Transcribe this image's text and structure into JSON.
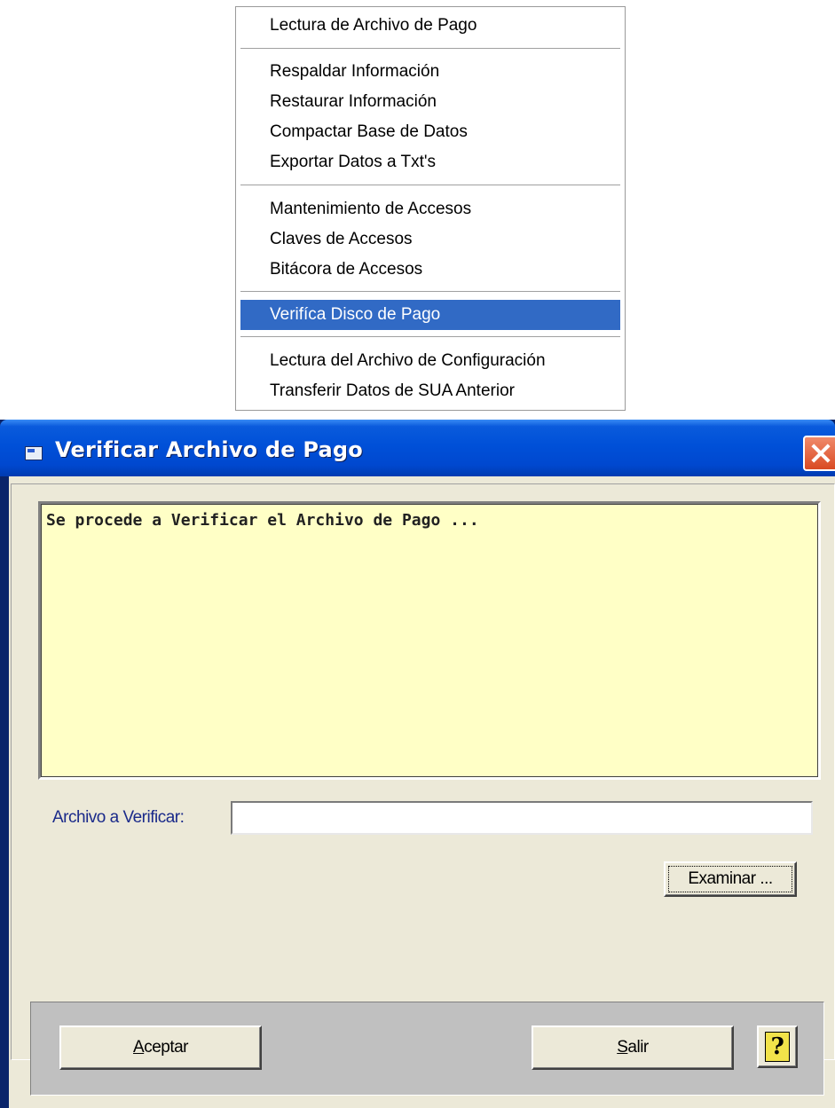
{
  "menu": {
    "items": [
      {
        "label": "Lectura de Archivo de Pago"
      },
      {
        "label": "Respaldar Información"
      },
      {
        "label": "Restaurar Información"
      },
      {
        "label": "Compactar Base de Datos"
      },
      {
        "label": "Exportar Datos a Txt's"
      },
      {
        "label": "Mantenimiento de Accesos"
      },
      {
        "label": "Claves de Accesos"
      },
      {
        "label": "Bitácora de Accesos"
      },
      {
        "label": "Verifíca Disco de Pago",
        "selected": true
      },
      {
        "label": "Lectura del Archivo de Configuración"
      },
      {
        "label": "Transferir Datos de SUA Anterior"
      }
    ]
  },
  "dialog": {
    "title": "Verificar Archivo de Pago",
    "icon": "window-icon",
    "log_text": "Se procede a Verificar el Archivo de Pago ...",
    "file_label": "Archivo a Verificar:",
    "file_value": "",
    "browse_label": "Examinar ...",
    "accept_label_rest": "ceptar",
    "accept_mnemonic": "A",
    "exit_label_rest": "alir",
    "exit_mnemonic": "S",
    "help_glyph": "?"
  },
  "colors": {
    "selection": "#316ac5",
    "title_bar": "#0050d8",
    "log_background": "#ffffc6",
    "window_body": "#ece9d8",
    "footer_panel": "#c0c0c0",
    "close_button": "#d94a23"
  }
}
